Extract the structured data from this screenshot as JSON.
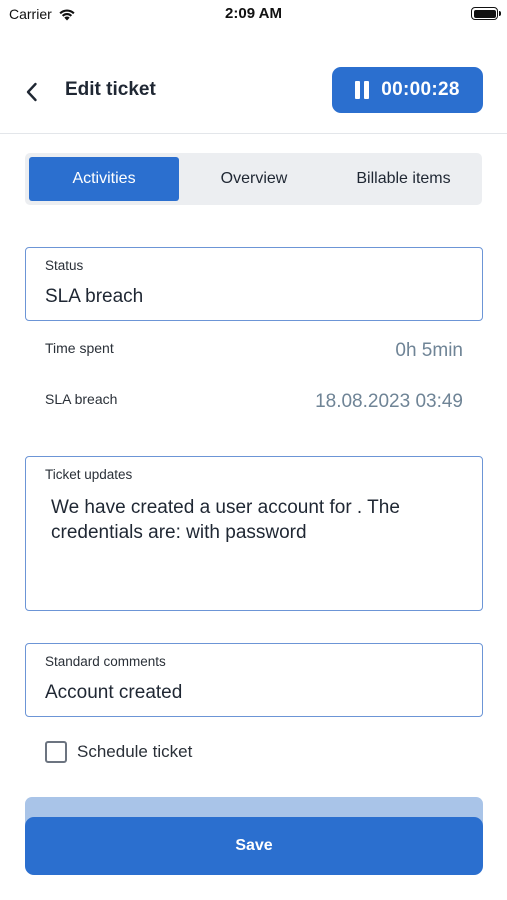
{
  "status_bar": {
    "carrier": "Carrier",
    "time": "2:09 AM",
    "icons": [
      "wifi-icon",
      "battery-icon"
    ]
  },
  "nav": {
    "back_icon": "chevron-left-icon",
    "title": "Edit ticket",
    "timer": {
      "icon": "pause-icon",
      "elapsed": "00:00:28"
    }
  },
  "tabs": [
    {
      "label": "Activities",
      "active": true
    },
    {
      "label": "Overview",
      "active": false
    },
    {
      "label": "Billable items",
      "active": false
    }
  ],
  "status_field": {
    "label": "Status",
    "value": "SLA breach"
  },
  "info": {
    "time_spent": {
      "label": "Time spent",
      "value": "0h 5min"
    },
    "sla_breach": {
      "label": "SLA breach",
      "value": "18.08.2023 03:49"
    }
  },
  "ticket_updates": {
    "label": "Ticket updates",
    "value": "We have created a user account for . The credentials are:  with password"
  },
  "standard_comments": {
    "label": "Standard comments",
    "value": "Account created"
  },
  "schedule": {
    "label": "Schedule ticket",
    "checked": false
  },
  "save_label": "Save",
  "colors": {
    "primary": "#2b6fcf",
    "field_border": "#6c95d6",
    "muted_value": "#6f8496",
    "tab_bg": "#eceef1"
  }
}
